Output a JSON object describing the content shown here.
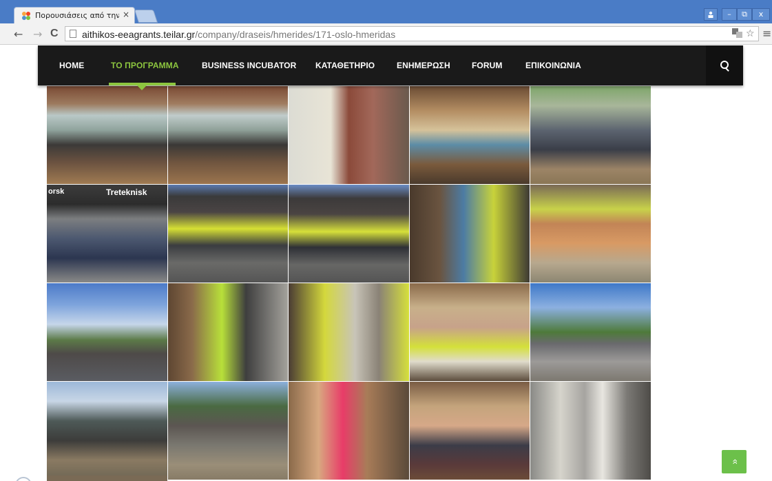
{
  "browser": {
    "tab_title": "Πορουσιάσεις από την επ",
    "tab_close": "×",
    "url_host": "aithikos-eeagrants.teilar.gr",
    "url_path": "/company/draseis/hmerides/171-oslo-hmeridas",
    "win_minimize": "–",
    "win_restore": "⧉",
    "win_close": "x",
    "back": "←",
    "forward": "→",
    "reload": "C",
    "star": "☆",
    "menu": "≡"
  },
  "nav": {
    "items": [
      {
        "label": "HOME",
        "active": false
      },
      {
        "label": "ΤΟ ΠΡΟΓΡΑΜΜΑ",
        "active": true
      },
      {
        "label": "BUSINESS INCUBATOR",
        "active": false
      },
      {
        "label": "ΚΑΤΑΘΕΤΗΡΙΟ",
        "active": false
      },
      {
        "label": "ΕΝΗΜΕΡΩΣΗ",
        "active": false
      },
      {
        "label": "FORUM",
        "active": false
      },
      {
        "label": "ΕΠΙΚΟΙΝΩΝΙΑ",
        "active": false
      }
    ],
    "accent_color": "#8dc63f",
    "search_icon": "search-icon"
  },
  "gallery": {
    "sign_treteknisk": "Treteknisk",
    "sign_orsk": "orsk",
    "photo_count": 20
  },
  "back_to_top": "»"
}
